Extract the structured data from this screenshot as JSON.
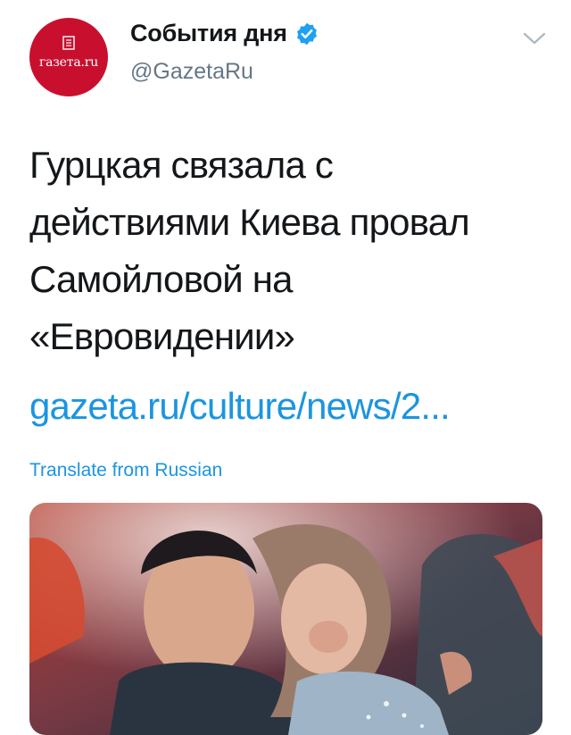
{
  "account": {
    "avatar_text": "газета.ru",
    "display_name": "События дня",
    "handle": "@GazetaRu",
    "verified": true
  },
  "tweet": {
    "text_lines": [
      "Гурцкая связала с",
      "действиями Киева провал",
      "Самойловой на",
      "«Евровидении»"
    ],
    "link_text": "gazeta.ru/culture/news/2...",
    "translate_label": "Translate from Russian"
  },
  "colors": {
    "avatar_bg": "#c8102e",
    "verified_blue": "#1da1f2",
    "link_blue": "#1b95e0",
    "secondary_text": "#657786"
  },
  "icons": {
    "verified": "verified-badge-icon",
    "menu": "chevron-down-icon",
    "avatar_glyph": "document-icon"
  }
}
